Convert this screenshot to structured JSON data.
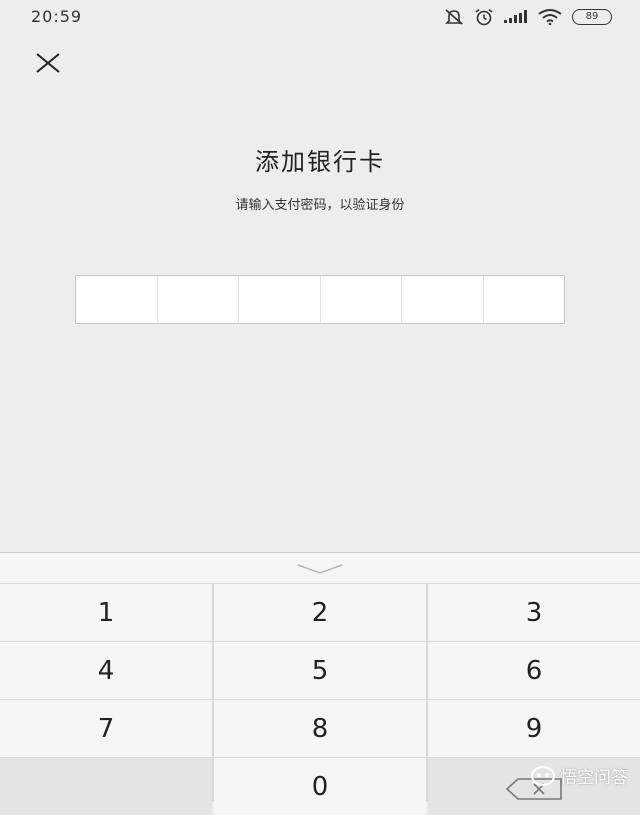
{
  "status": {
    "time": "20:59",
    "battery": "89"
  },
  "header": {
    "title": "添加银行卡",
    "subtitle": "请输入支付密码，以验证身份"
  },
  "pin": {
    "length": 6
  },
  "keyboard": {
    "keys": [
      "1",
      "2",
      "3",
      "4",
      "5",
      "6",
      "7",
      "8",
      "9",
      "",
      "0",
      "⌫"
    ]
  },
  "watermark": {
    "text": "悟空问答"
  }
}
